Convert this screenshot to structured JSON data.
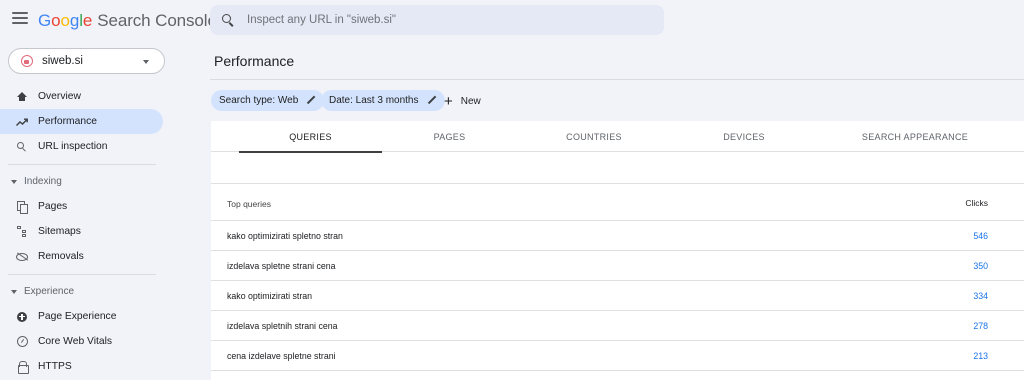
{
  "app": {
    "logo_letters": [
      "G",
      "o",
      "o",
      "g",
      "l",
      "e"
    ],
    "product": "Search Console"
  },
  "search": {
    "placeholder": "Inspect any URL in \"siweb.si\""
  },
  "property": {
    "name": "siweb.si"
  },
  "sidebar": {
    "items": [
      {
        "label": "Overview",
        "icon": "home-icon",
        "active": false
      },
      {
        "label": "Performance",
        "icon": "trending-up-icon",
        "active": true
      },
      {
        "label": "URL inspection",
        "icon": "search-icon",
        "active": false
      }
    ],
    "sections": [
      {
        "label": "Indexing",
        "items": [
          {
            "label": "Pages",
            "icon": "pages-icon"
          },
          {
            "label": "Sitemaps",
            "icon": "sitemap-icon"
          },
          {
            "label": "Removals",
            "icon": "visibility-off-icon"
          }
        ]
      },
      {
        "label": "Experience",
        "items": [
          {
            "label": "Page Experience",
            "icon": "add-circle-icon"
          },
          {
            "label": "Core Web Vitals",
            "icon": "speed-gauge-icon"
          },
          {
            "label": "HTTPS",
            "icon": "lock-icon"
          }
        ]
      }
    ]
  },
  "main": {
    "title": "Performance",
    "filters": [
      {
        "label": "Search type: Web"
      },
      {
        "label": "Date: Last 3 months"
      }
    ],
    "new_label": "New",
    "tabs": [
      {
        "label": "QUERIES",
        "active": true
      },
      {
        "label": "PAGES",
        "active": false
      },
      {
        "label": "COUNTRIES",
        "active": false
      },
      {
        "label": "DEVICES",
        "active": false
      },
      {
        "label": "SEARCH APPEARANCE",
        "active": false
      }
    ],
    "table": {
      "headers": {
        "query": "Top queries",
        "clicks": "Clicks"
      },
      "rows": [
        {
          "query": "kako optimizirati spletno stran",
          "clicks": "546"
        },
        {
          "query": "izdelava spletne strani cena",
          "clicks": "350"
        },
        {
          "query": "kako optimizirati stran",
          "clicks": "334"
        },
        {
          "query": "izdelava spletnih strani cena",
          "clicks": "278"
        },
        {
          "query": "cena izdelave spletne strani",
          "clicks": "213"
        }
      ]
    }
  },
  "colors": {
    "background": "#f1f3f9",
    "accent_chip": "#d3e3fd",
    "link_blue": "#1a73e8"
  }
}
